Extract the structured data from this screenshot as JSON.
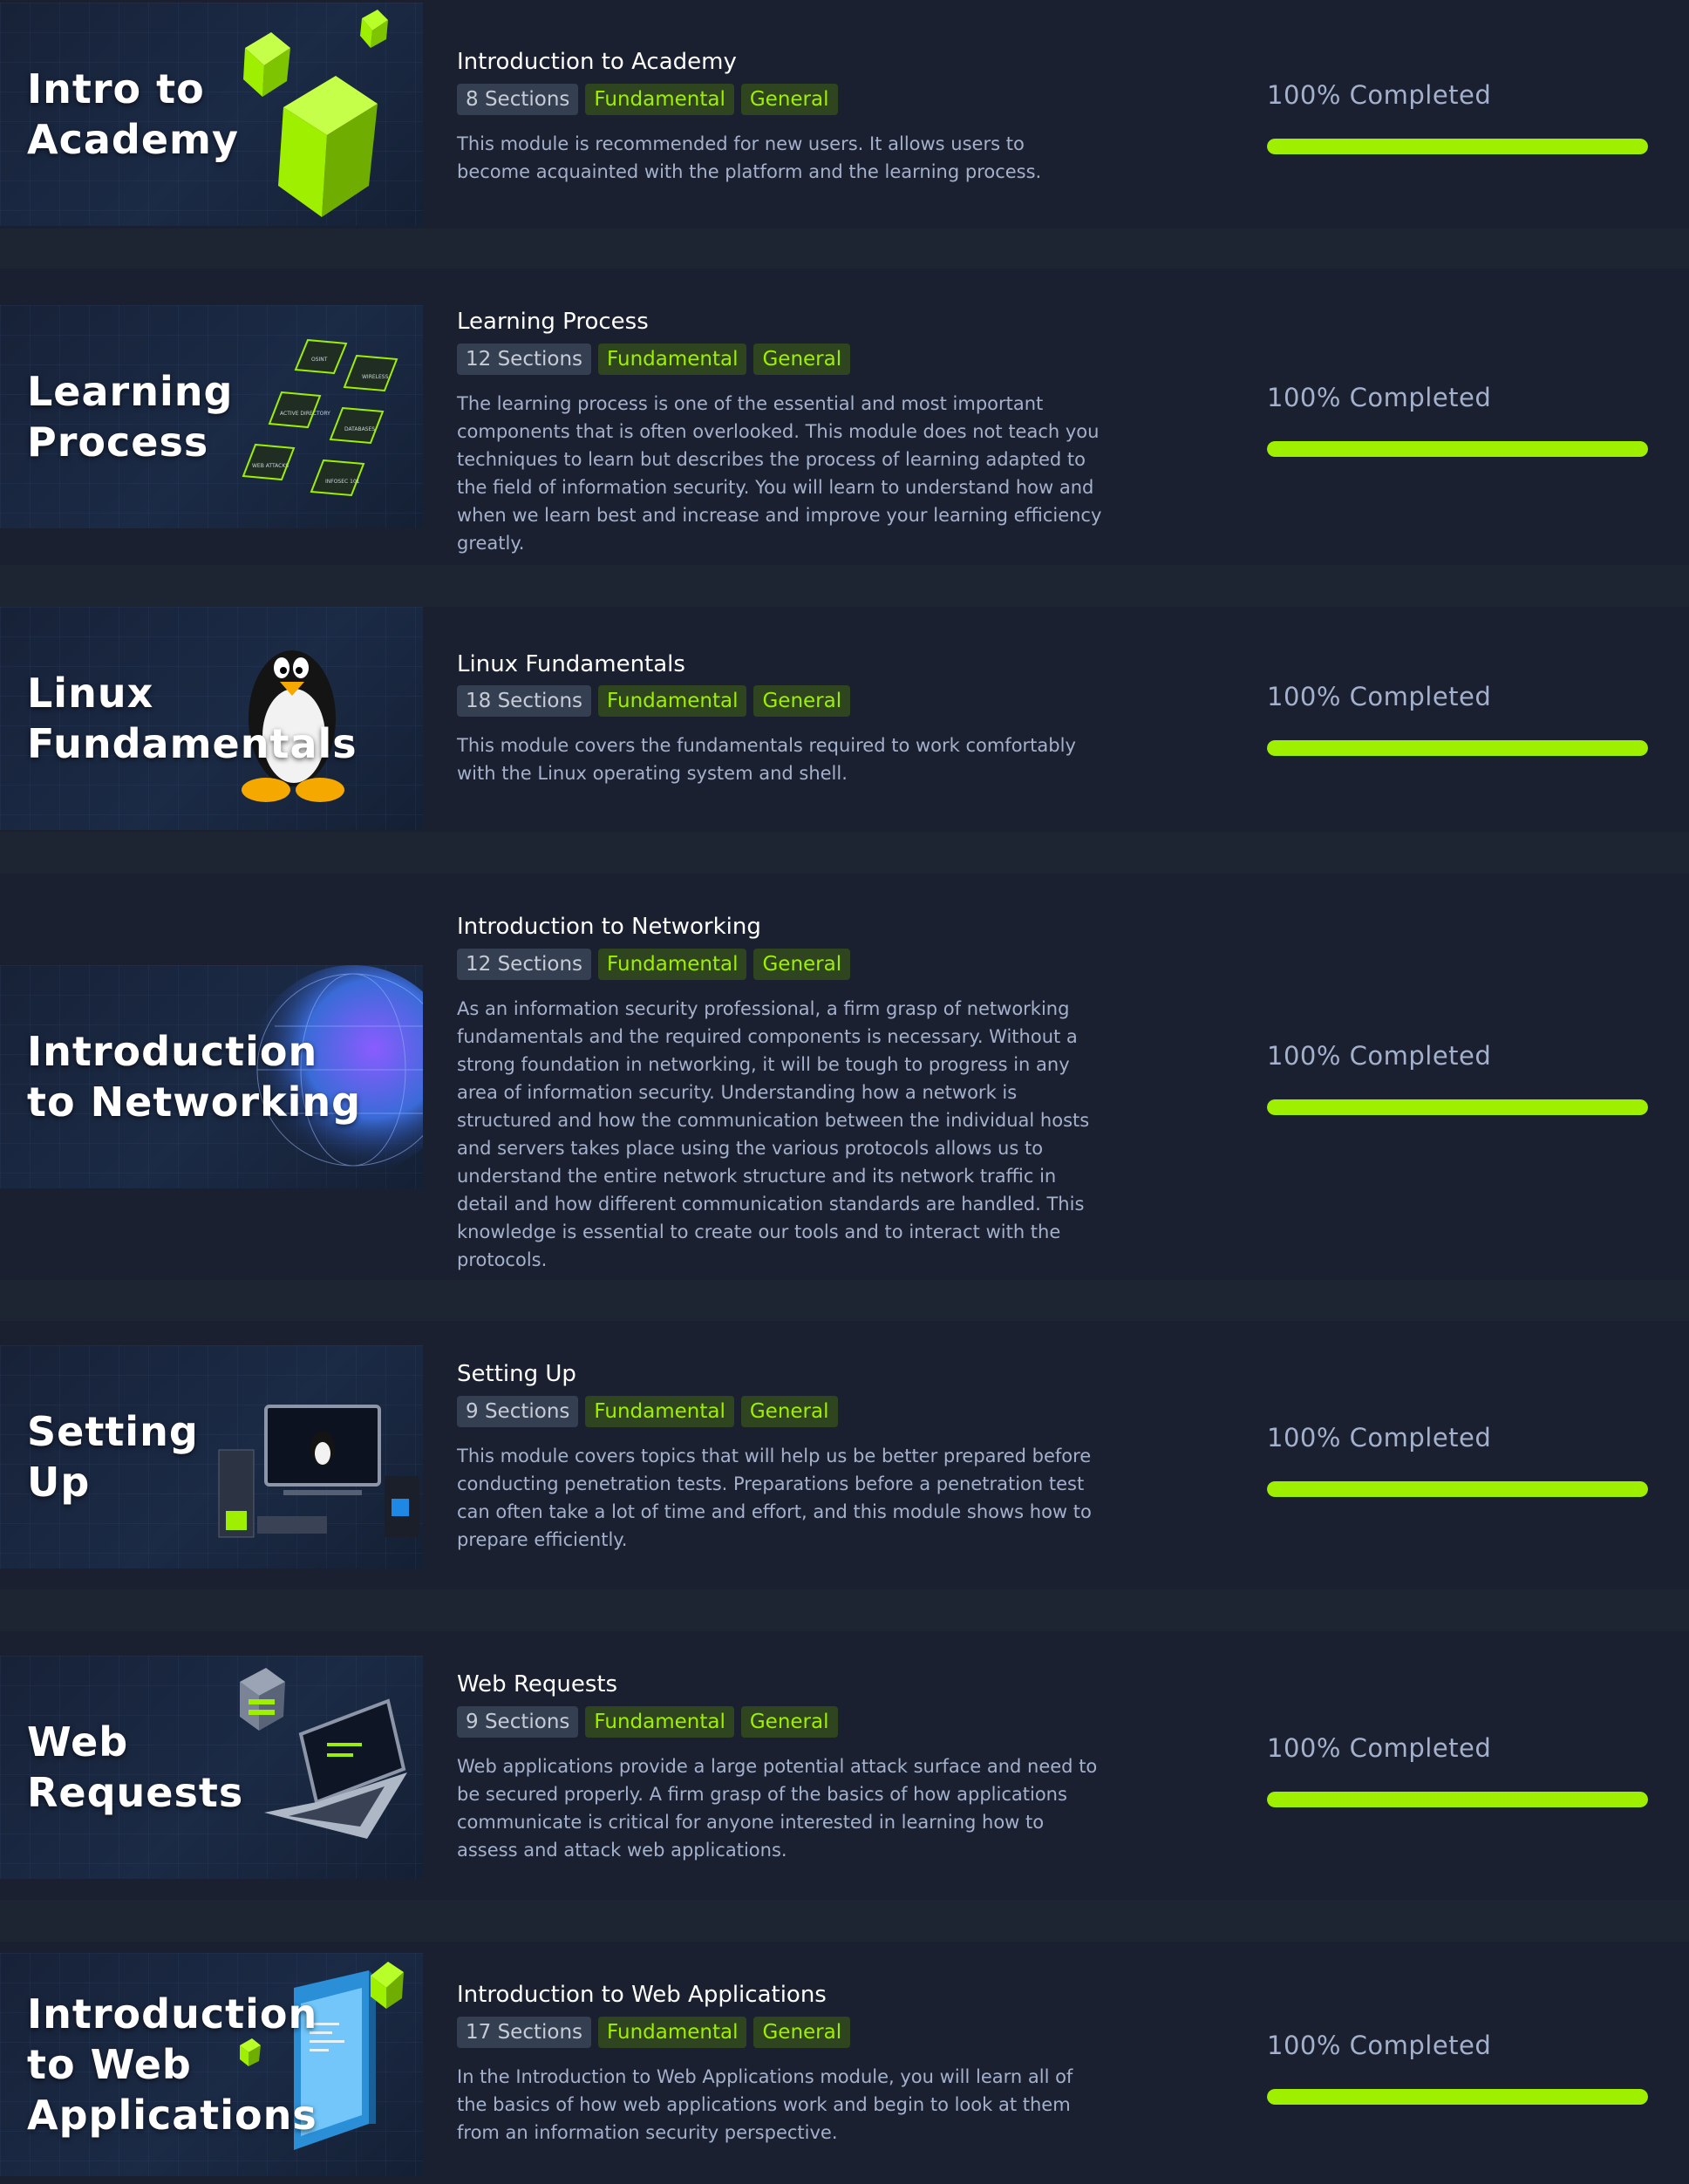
{
  "accent_color": "#9fef00",
  "modules": [
    {
      "thumb_title": "Intro to\nAcademy",
      "art": "green-cubes",
      "title": "Introduction to Academy",
      "sections": "8 Sections",
      "tags": [
        "Fundamental",
        "General"
      ],
      "description": "This module is recommended for new users. It allows users to become acquainted with the platform and the learning process.",
      "progress_label": "100% Completed",
      "progress_percent": 100
    },
    {
      "thumb_title": "Learning\nProcess",
      "art": "learning-tiles",
      "art_labels": [
        "OSINT",
        "WIRELESS",
        "ACTIVE DIRECTORY",
        "DATABASES",
        "WEB ATTACKS",
        "INFOSEC 101"
      ],
      "title": "Learning Process",
      "sections": "12 Sections",
      "tags": [
        "Fundamental",
        "General"
      ],
      "description": "The learning process is one of the essential and most important components that is often overlooked. This module does not teach you techniques to learn but describes the process of learning adapted to the field of information security. You will learn to understand how and when we learn best and increase and improve your learning efficiency greatly.",
      "progress_label": "100% Completed",
      "progress_percent": 100
    },
    {
      "thumb_title": "Linux\nFundamentals",
      "art": "penguin",
      "title": "Linux Fundamentals",
      "sections": "18 Sections",
      "tags": [
        "Fundamental",
        "General"
      ],
      "description": "This module covers the fundamentals required to work comfortably with the Linux operating system and shell.",
      "progress_label": "100% Completed",
      "progress_percent": 100
    },
    {
      "thumb_title": "Introduction\nto Networking",
      "art": "globe",
      "title": "Introduction to Networking",
      "sections": "12 Sections",
      "tags": [
        "Fundamental",
        "General"
      ],
      "description": "As an information security professional, a firm grasp of networking fundamentals and the required components is necessary. Without a strong foundation in networking, it will be tough to progress in any area of information security. Understanding how a network is structured and how the communication between the individual hosts and servers takes place using the various protocols allows us to understand the entire network structure and its network traffic in detail and how different communication standards are handled. This knowledge is essential to create our tools and to interact with the protocols.",
      "progress_label": "100% Completed",
      "progress_percent": 100
    },
    {
      "thumb_title": "Setting\nUp",
      "art": "workstation",
      "title": "Setting Up",
      "sections": "9 Sections",
      "tags": [
        "Fundamental",
        "General"
      ],
      "description": "This module covers topics that will help us be better prepared before conducting penetration tests. Preparations before a penetration test can often take a lot of time and effort, and this module shows how to prepare efficiently.",
      "progress_label": "100% Completed",
      "progress_percent": 100
    },
    {
      "thumb_title": "Web\nRequests",
      "art": "laptop",
      "title": "Web Requests",
      "sections": "9 Sections",
      "tags": [
        "Fundamental",
        "General"
      ],
      "description": "Web applications provide a large potential attack surface and need to be secured properly. A firm grasp of the basics of how applications communicate is critical for anyone interested in learning how to assess and attack web applications.",
      "progress_label": "100% Completed",
      "progress_percent": 100
    },
    {
      "thumb_title": "Introduction\nto Web\nApplications",
      "art": "browser-window",
      "title": "Introduction to Web Applications",
      "sections": "17 Sections",
      "tags": [
        "Fundamental",
        "General"
      ],
      "description": "In the Introduction to Web Applications module, you will learn all of the basics of how web applications work and begin to look at them from an information security perspective.",
      "progress_label": "100% Completed",
      "progress_percent": 100
    }
  ]
}
